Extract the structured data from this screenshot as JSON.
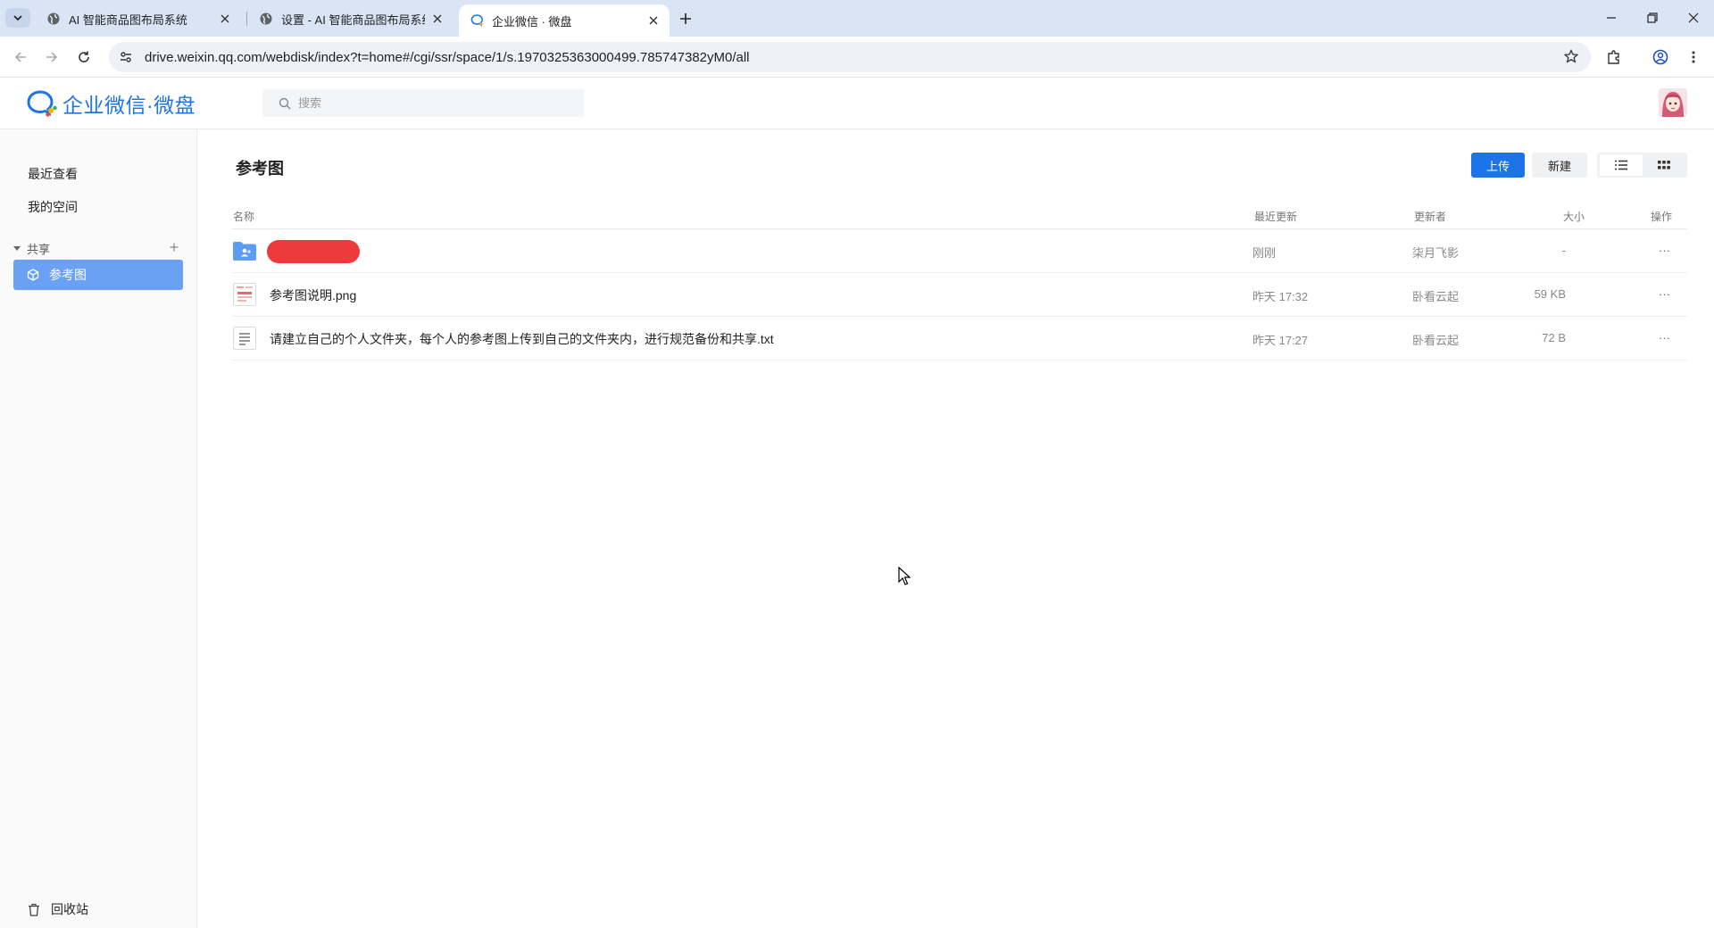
{
  "browser": {
    "tabs": [
      {
        "title": "AI 智能商品图布局系统",
        "active": false
      },
      {
        "title": "设置 - AI 智能商品图布局系统",
        "active": false
      },
      {
        "title": "企业微信 · 微盘",
        "active": true
      }
    ],
    "url": "drive.weixin.qq.com/webdisk/index?t=home#/cgi/ssr/space/1/s.1970325363000499.785747382yM0/all"
  },
  "header": {
    "logo_text": "企业微信·微盘",
    "search_placeholder": "搜索"
  },
  "sidebar": {
    "recent": "最近查看",
    "my_space": "我的空间",
    "shared_label": "共享",
    "active_item": "参考图",
    "recycle": "回收站"
  },
  "main": {
    "title": "参考图",
    "upload_label": "上传",
    "new_label": "新建",
    "columns": {
      "name": "名称",
      "updated": "最近更新",
      "updater": "更新者",
      "size": "大小",
      "actions": "操作"
    },
    "rows": [
      {
        "type": "shared-folder",
        "name": "",
        "updated": "刚刚",
        "updater": "柒月飞影",
        "size": "-",
        "more": "···"
      },
      {
        "type": "image",
        "name": "参考图说明.png",
        "updated": "昨天 17:32",
        "updater": "卧看云起",
        "size": "59 KB",
        "more": "···"
      },
      {
        "type": "text",
        "name": "请建立自己的个人文件夹，每个人的参考图上传到自己的文件夹内，进行规范备份和共享.txt",
        "updated": "昨天 17:27",
        "updater": "卧看云起",
        "size": "72 B",
        "more": "···"
      }
    ]
  },
  "colors": {
    "accent": "#1d74e8",
    "sidebar_active": "#6aa1f5",
    "redaction": "#ec3a3d",
    "tabstrip": "#d9e4f5"
  }
}
